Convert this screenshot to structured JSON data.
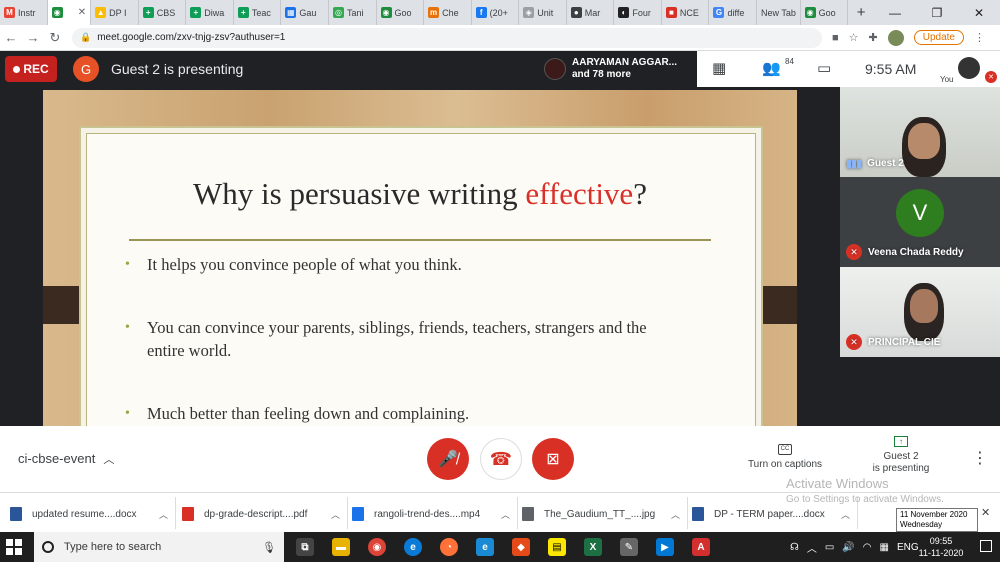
{
  "browser": {
    "tabs": [
      {
        "label": "Instr",
        "fav_color": "#ea4335",
        "fav_glyph": "M"
      },
      {
        "label": "",
        "fav_color": "#1e8e3e",
        "fav_glyph": "◉",
        "active": true
      },
      {
        "label": "DP I",
        "fav_color": "#fbbc04",
        "fav_glyph": "▲"
      },
      {
        "label": "CBS",
        "fav_color": "#0f9d58",
        "fav_glyph": "+"
      },
      {
        "label": "Diwa",
        "fav_color": "#0f9d58",
        "fav_glyph": "+"
      },
      {
        "label": "Teac",
        "fav_color": "#0f9d58",
        "fav_glyph": "+"
      },
      {
        "label": "Gau",
        "fav_color": "#1a73e8",
        "fav_glyph": "▦"
      },
      {
        "label": "Tani",
        "fav_color": "#34a853",
        "fav_glyph": "◎"
      },
      {
        "label": "Goo",
        "fav_color": "#1e8e3e",
        "fav_glyph": "◉"
      },
      {
        "label": "Che",
        "fav_color": "#e8710a",
        "fav_glyph": "m"
      },
      {
        "label": "(20+",
        "fav_color": "#1877f2",
        "fav_glyph": "f"
      },
      {
        "label": "Unit",
        "fav_color": "#9aa0a6",
        "fav_glyph": "◈"
      },
      {
        "label": "Mar",
        "fav_color": "#3c4043",
        "fav_glyph": "●"
      },
      {
        "label": "Four",
        "fav_color": "#202124",
        "fav_glyph": "◐"
      },
      {
        "label": "NCE",
        "fav_color": "#d93025",
        "fav_glyph": "■"
      },
      {
        "label": "diffe",
        "fav_color": "#4285f4",
        "fav_glyph": "G"
      },
      {
        "label": "New Tab",
        "fav_color": "",
        "fav_glyph": ""
      },
      {
        "label": "Goo",
        "fav_color": "#1e8e3e",
        "fav_glyph": "◉"
      }
    ],
    "url": "meet.google.com/zxv-tnjg-zsv?authuser=1",
    "update_label": "Update"
  },
  "meet": {
    "rec_label": "REC",
    "presenter_initial": "G",
    "presenter_text": "Guest 2 is presenting",
    "participants_name": "AARYAMAN AGGAR...",
    "participants_more": "and 78 more",
    "people_count": "84",
    "time": "9:55 AM",
    "you_label": "You"
  },
  "slide": {
    "title_prefix": "Why is persuasive writing ",
    "title_highlight": "effective",
    "title_suffix": "?",
    "bullets": [
      "It helps you convince people of what you think.",
      "You can convince your parents, siblings, friends, teachers, strangers and the entire world.",
      "Much better than feeling down and complaining."
    ]
  },
  "tiles": [
    {
      "name": "Guest 2",
      "initial": ""
    },
    {
      "name": "Veena Chada Reddy",
      "initial": "V"
    },
    {
      "name": "PRINCIPAL CIE",
      "initial": ""
    }
  ],
  "controls": {
    "meeting_code": "ci-cbse-event",
    "captions_label": "Turn on captions",
    "present_line1": "Guest 2",
    "present_line2": "is presenting"
  },
  "downloads": [
    {
      "name": "updated resume....docx",
      "type": "docx",
      "color": "#2b579a"
    },
    {
      "name": "dp-grade-descript....pdf",
      "type": "pdf",
      "color": "#d93025"
    },
    {
      "name": "rangoli-trend-des....mp4",
      "type": "mp4",
      "color": "#1a73e8"
    },
    {
      "name": "The_Gaudium_TT_....jpg",
      "type": "jpg",
      "color": "#5f6368"
    },
    {
      "name": "DP - TERM paper....docx",
      "type": "docx",
      "color": "#2b579a"
    }
  ],
  "watermark": {
    "line1": "Activate Windows",
    "line2": "Go to Settings to activate Windows."
  },
  "date_tooltip": {
    "line1": "11 November 2020",
    "line2": "Wednesday"
  },
  "taskbar": {
    "search_placeholder": "Type here to search",
    "lang": "ENG",
    "time": "09:55",
    "date": "11-11-2020"
  }
}
